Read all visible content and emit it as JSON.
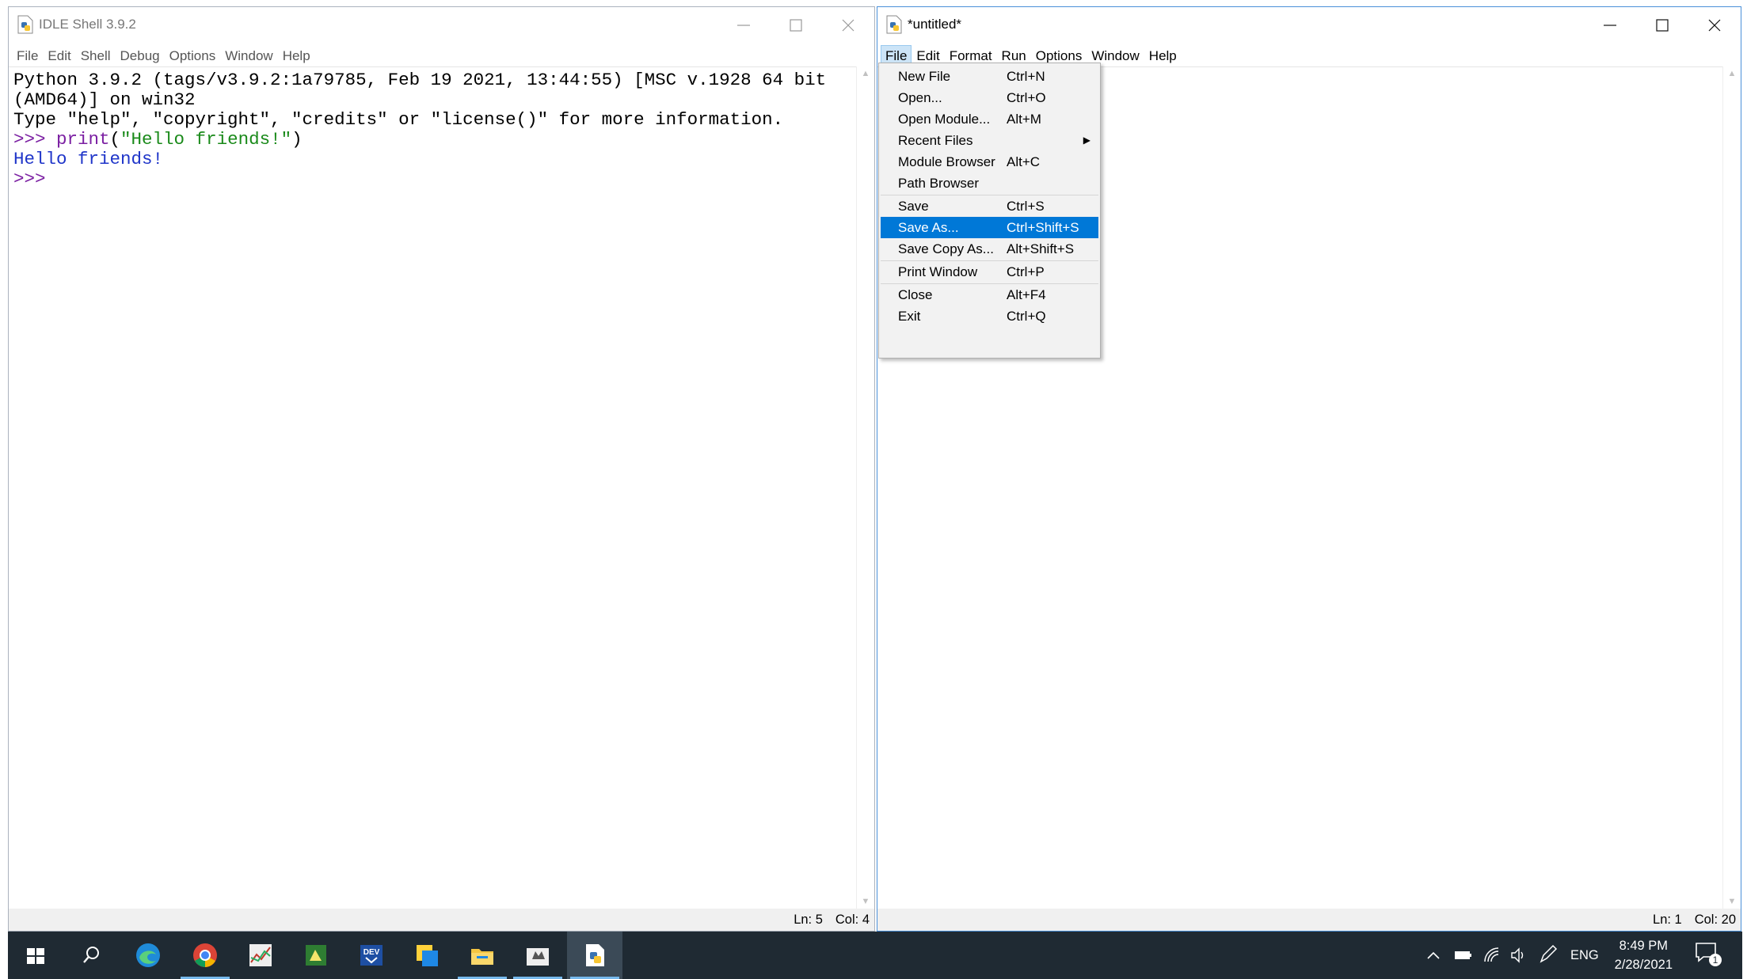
{
  "shell": {
    "title": "IDLE Shell 3.9.2",
    "menu": [
      "File",
      "Edit",
      "Shell",
      "Debug",
      "Options",
      "Window",
      "Help"
    ],
    "lines": [
      {
        "parts": [
          {
            "text": "Python 3.9.2 (tags/v3.9.2:1a79785, Feb 19 2021, 13:44:55) [MSC v.1928 64 bit",
            "color": "black"
          }
        ]
      },
      {
        "parts": [
          {
            "text": "(AMD64)] on win32",
            "color": "black"
          }
        ]
      },
      {
        "parts": [
          {
            "text": "Type \"help\", \"copyright\", \"credits\" or \"license()\" for more information.",
            "color": "black"
          }
        ]
      },
      {
        "parts": [
          {
            "text": ">>> ",
            "color": "prompt"
          },
          {
            "text": "print",
            "color": "prompt"
          },
          {
            "text": "(",
            "color": "black"
          },
          {
            "text": "\"Hello friends!\"",
            "color": "str"
          },
          {
            "text": ")",
            "color": "black"
          }
        ]
      },
      {
        "parts": [
          {
            "text": "Hello friends!",
            "color": "out"
          }
        ]
      },
      {
        "parts": [
          {
            "text": ">>> ",
            "color": "prompt"
          }
        ]
      }
    ],
    "status": {
      "ln": "Ln: 5",
      "col": "Col: 4"
    }
  },
  "editor": {
    "title": "*untitled*",
    "menu": [
      "File",
      "Edit",
      "Format",
      "Run",
      "Options",
      "Window",
      "Help"
    ],
    "open_menu": "File",
    "status": {
      "ln": "Ln: 1",
      "col": "Col: 20"
    }
  },
  "file_menu": {
    "items": [
      {
        "label": "New File",
        "accel": "Ctrl+N"
      },
      {
        "label": "Open...",
        "accel": "Ctrl+O"
      },
      {
        "label": "Open Module...",
        "accel": "Alt+M"
      },
      {
        "label": "Recent Files",
        "accel": "",
        "submenu": true
      },
      {
        "label": "Module Browser",
        "accel": "Alt+C"
      },
      {
        "label": "Path Browser",
        "accel": ""
      },
      {
        "separator": true
      },
      {
        "label": "Save",
        "accel": "Ctrl+S"
      },
      {
        "label": "Save As...",
        "accel": "Ctrl+Shift+S",
        "selected": true
      },
      {
        "label": "Save Copy As...",
        "accel": "Alt+Shift+S"
      },
      {
        "separator": true
      },
      {
        "label": "Print Window",
        "accel": "Ctrl+P"
      },
      {
        "separator": true
      },
      {
        "label": "Close",
        "accel": "Alt+F4"
      },
      {
        "label": "Exit",
        "accel": "Ctrl+Q"
      }
    ]
  },
  "taskbar": {
    "apps": [
      {
        "name": "start-icon"
      },
      {
        "name": "search-icon"
      },
      {
        "name": "edge-icon"
      },
      {
        "name": "chrome-icon",
        "running": true
      },
      {
        "name": "chart-app-icon"
      },
      {
        "name": "python-file-icon"
      },
      {
        "name": "dev-app-icon"
      },
      {
        "name": "sticky-notes-icon"
      },
      {
        "name": "file-explorer-icon",
        "running": true
      },
      {
        "name": "cat-app-icon",
        "running": true
      },
      {
        "name": "idle-icon",
        "running": true,
        "active": true
      }
    ],
    "tray": {
      "language": "ENG",
      "time": "8:49 PM",
      "date": "2/28/2021",
      "notifications": "1"
    }
  },
  "colors": {
    "selection": "#0078d7",
    "taskbar": "#1f2a33",
    "prompt": "#7b1fa2",
    "output": "#1f35c9",
    "string": "#1a8a1a"
  }
}
